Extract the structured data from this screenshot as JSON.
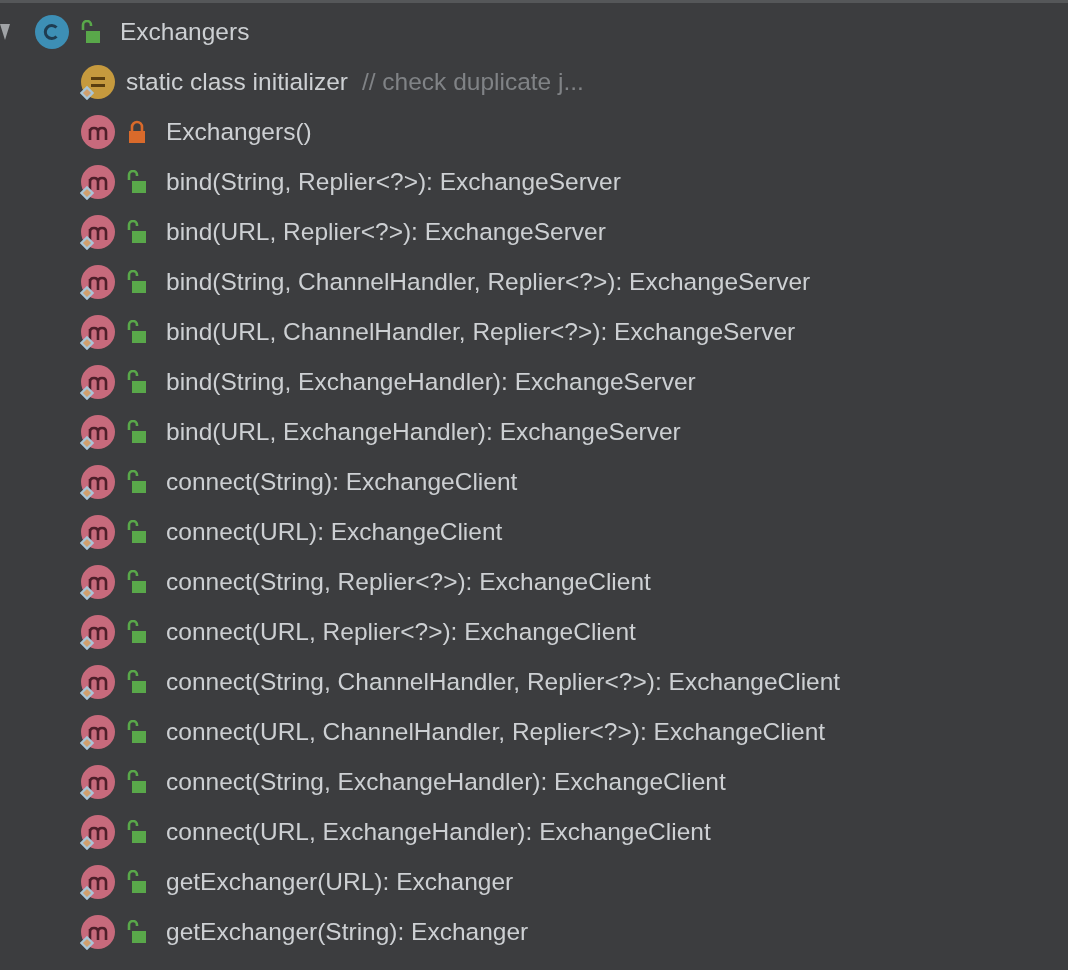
{
  "tree": {
    "label": "Exchangers",
    "kind": "class",
    "locked": false,
    "static": false,
    "expanded": true,
    "children": [
      {
        "label": "static class initializer",
        "comment": "// check duplicate j...",
        "kind": "initializer",
        "static": true
      },
      {
        "label": "Exchangers()",
        "kind": "method",
        "locked": true,
        "static": false
      },
      {
        "label": "bind(String, Replier<?>): ExchangeServer",
        "kind": "method",
        "locked": false,
        "static": true
      },
      {
        "label": "bind(URL, Replier<?>): ExchangeServer",
        "kind": "method",
        "locked": false,
        "static": true
      },
      {
        "label": "bind(String, ChannelHandler, Replier<?>): ExchangeServer",
        "kind": "method",
        "locked": false,
        "static": true
      },
      {
        "label": "bind(URL, ChannelHandler, Replier<?>): ExchangeServer",
        "kind": "method",
        "locked": false,
        "static": true
      },
      {
        "label": "bind(String, ExchangeHandler): ExchangeServer",
        "kind": "method",
        "locked": false,
        "static": true
      },
      {
        "label": "bind(URL, ExchangeHandler): ExchangeServer",
        "kind": "method",
        "locked": false,
        "static": true
      },
      {
        "label": "connect(String): ExchangeClient",
        "kind": "method",
        "locked": false,
        "static": true
      },
      {
        "label": "connect(URL): ExchangeClient",
        "kind": "method",
        "locked": false,
        "static": true
      },
      {
        "label": "connect(String, Replier<?>): ExchangeClient",
        "kind": "method",
        "locked": false,
        "static": true
      },
      {
        "label": "connect(URL, Replier<?>): ExchangeClient",
        "kind": "method",
        "locked": false,
        "static": true
      },
      {
        "label": "connect(String, ChannelHandler, Replier<?>): ExchangeClient",
        "kind": "method",
        "locked": false,
        "static": true
      },
      {
        "label": "connect(URL, ChannelHandler, Replier<?>): ExchangeClient",
        "kind": "method",
        "locked": false,
        "static": true
      },
      {
        "label": "connect(String, ExchangeHandler): ExchangeClient",
        "kind": "method",
        "locked": false,
        "static": true
      },
      {
        "label": "connect(URL, ExchangeHandler): ExchangeClient",
        "kind": "method",
        "locked": false,
        "static": true
      },
      {
        "label": "getExchanger(URL): Exchanger",
        "kind": "method",
        "locked": false,
        "static": true
      },
      {
        "label": "getExchanger(String): Exchanger",
        "kind": "method",
        "locked": false,
        "static": true
      }
    ]
  }
}
